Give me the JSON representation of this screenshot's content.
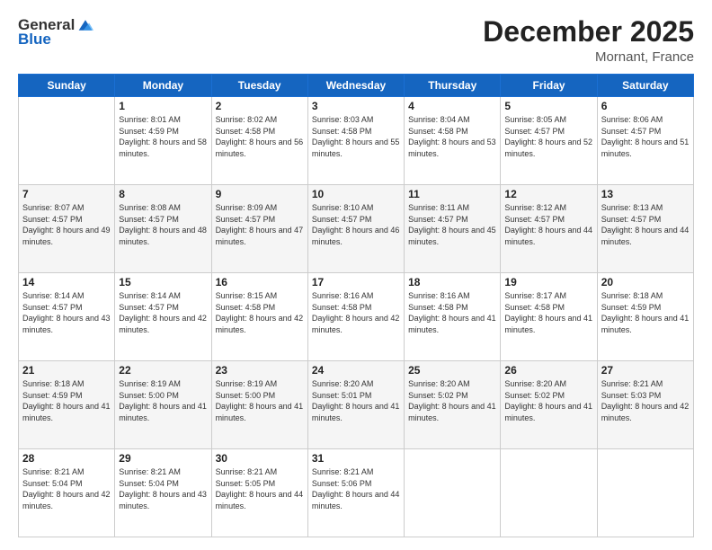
{
  "logo": {
    "general": "General",
    "blue": "Blue"
  },
  "header": {
    "month": "December 2025",
    "location": "Mornant, France"
  },
  "weekdays": [
    "Sunday",
    "Monday",
    "Tuesday",
    "Wednesday",
    "Thursday",
    "Friday",
    "Saturday"
  ],
  "weeks": [
    [
      {
        "day": "",
        "sunrise": "",
        "sunset": "",
        "daylight": ""
      },
      {
        "day": "1",
        "sunrise": "Sunrise: 8:01 AM",
        "sunset": "Sunset: 4:59 PM",
        "daylight": "Daylight: 8 hours and 58 minutes."
      },
      {
        "day": "2",
        "sunrise": "Sunrise: 8:02 AM",
        "sunset": "Sunset: 4:58 PM",
        "daylight": "Daylight: 8 hours and 56 minutes."
      },
      {
        "day": "3",
        "sunrise": "Sunrise: 8:03 AM",
        "sunset": "Sunset: 4:58 PM",
        "daylight": "Daylight: 8 hours and 55 minutes."
      },
      {
        "day": "4",
        "sunrise": "Sunrise: 8:04 AM",
        "sunset": "Sunset: 4:58 PM",
        "daylight": "Daylight: 8 hours and 53 minutes."
      },
      {
        "day": "5",
        "sunrise": "Sunrise: 8:05 AM",
        "sunset": "Sunset: 4:57 PM",
        "daylight": "Daylight: 8 hours and 52 minutes."
      },
      {
        "day": "6",
        "sunrise": "Sunrise: 8:06 AM",
        "sunset": "Sunset: 4:57 PM",
        "daylight": "Daylight: 8 hours and 51 minutes."
      }
    ],
    [
      {
        "day": "7",
        "sunrise": "Sunrise: 8:07 AM",
        "sunset": "Sunset: 4:57 PM",
        "daylight": "Daylight: 8 hours and 49 minutes."
      },
      {
        "day": "8",
        "sunrise": "Sunrise: 8:08 AM",
        "sunset": "Sunset: 4:57 PM",
        "daylight": "Daylight: 8 hours and 48 minutes."
      },
      {
        "day": "9",
        "sunrise": "Sunrise: 8:09 AM",
        "sunset": "Sunset: 4:57 PM",
        "daylight": "Daylight: 8 hours and 47 minutes."
      },
      {
        "day": "10",
        "sunrise": "Sunrise: 8:10 AM",
        "sunset": "Sunset: 4:57 PM",
        "daylight": "Daylight: 8 hours and 46 minutes."
      },
      {
        "day": "11",
        "sunrise": "Sunrise: 8:11 AM",
        "sunset": "Sunset: 4:57 PM",
        "daylight": "Daylight: 8 hours and 45 minutes."
      },
      {
        "day": "12",
        "sunrise": "Sunrise: 8:12 AM",
        "sunset": "Sunset: 4:57 PM",
        "daylight": "Daylight: 8 hours and 44 minutes."
      },
      {
        "day": "13",
        "sunrise": "Sunrise: 8:13 AM",
        "sunset": "Sunset: 4:57 PM",
        "daylight": "Daylight: 8 hours and 44 minutes."
      }
    ],
    [
      {
        "day": "14",
        "sunrise": "Sunrise: 8:14 AM",
        "sunset": "Sunset: 4:57 PM",
        "daylight": "Daylight: 8 hours and 43 minutes."
      },
      {
        "day": "15",
        "sunrise": "Sunrise: 8:14 AM",
        "sunset": "Sunset: 4:57 PM",
        "daylight": "Daylight: 8 hours and 42 minutes."
      },
      {
        "day": "16",
        "sunrise": "Sunrise: 8:15 AM",
        "sunset": "Sunset: 4:58 PM",
        "daylight": "Daylight: 8 hours and 42 minutes."
      },
      {
        "day": "17",
        "sunrise": "Sunrise: 8:16 AM",
        "sunset": "Sunset: 4:58 PM",
        "daylight": "Daylight: 8 hours and 42 minutes."
      },
      {
        "day": "18",
        "sunrise": "Sunrise: 8:16 AM",
        "sunset": "Sunset: 4:58 PM",
        "daylight": "Daylight: 8 hours and 41 minutes."
      },
      {
        "day": "19",
        "sunrise": "Sunrise: 8:17 AM",
        "sunset": "Sunset: 4:58 PM",
        "daylight": "Daylight: 8 hours and 41 minutes."
      },
      {
        "day": "20",
        "sunrise": "Sunrise: 8:18 AM",
        "sunset": "Sunset: 4:59 PM",
        "daylight": "Daylight: 8 hours and 41 minutes."
      }
    ],
    [
      {
        "day": "21",
        "sunrise": "Sunrise: 8:18 AM",
        "sunset": "Sunset: 4:59 PM",
        "daylight": "Daylight: 8 hours and 41 minutes."
      },
      {
        "day": "22",
        "sunrise": "Sunrise: 8:19 AM",
        "sunset": "Sunset: 5:00 PM",
        "daylight": "Daylight: 8 hours and 41 minutes."
      },
      {
        "day": "23",
        "sunrise": "Sunrise: 8:19 AM",
        "sunset": "Sunset: 5:00 PM",
        "daylight": "Daylight: 8 hours and 41 minutes."
      },
      {
        "day": "24",
        "sunrise": "Sunrise: 8:20 AM",
        "sunset": "Sunset: 5:01 PM",
        "daylight": "Daylight: 8 hours and 41 minutes."
      },
      {
        "day": "25",
        "sunrise": "Sunrise: 8:20 AM",
        "sunset": "Sunset: 5:02 PM",
        "daylight": "Daylight: 8 hours and 41 minutes."
      },
      {
        "day": "26",
        "sunrise": "Sunrise: 8:20 AM",
        "sunset": "Sunset: 5:02 PM",
        "daylight": "Daylight: 8 hours and 41 minutes."
      },
      {
        "day": "27",
        "sunrise": "Sunrise: 8:21 AM",
        "sunset": "Sunset: 5:03 PM",
        "daylight": "Daylight: 8 hours and 42 minutes."
      }
    ],
    [
      {
        "day": "28",
        "sunrise": "Sunrise: 8:21 AM",
        "sunset": "Sunset: 5:04 PM",
        "daylight": "Daylight: 8 hours and 42 minutes."
      },
      {
        "day": "29",
        "sunrise": "Sunrise: 8:21 AM",
        "sunset": "Sunset: 5:04 PM",
        "daylight": "Daylight: 8 hours and 43 minutes."
      },
      {
        "day": "30",
        "sunrise": "Sunrise: 8:21 AM",
        "sunset": "Sunset: 5:05 PM",
        "daylight": "Daylight: 8 hours and 44 minutes."
      },
      {
        "day": "31",
        "sunrise": "Sunrise: 8:21 AM",
        "sunset": "Sunset: 5:06 PM",
        "daylight": "Daylight: 8 hours and 44 minutes."
      },
      {
        "day": "",
        "sunrise": "",
        "sunset": "",
        "daylight": ""
      },
      {
        "day": "",
        "sunrise": "",
        "sunset": "",
        "daylight": ""
      },
      {
        "day": "",
        "sunrise": "",
        "sunset": "",
        "daylight": ""
      }
    ]
  ]
}
